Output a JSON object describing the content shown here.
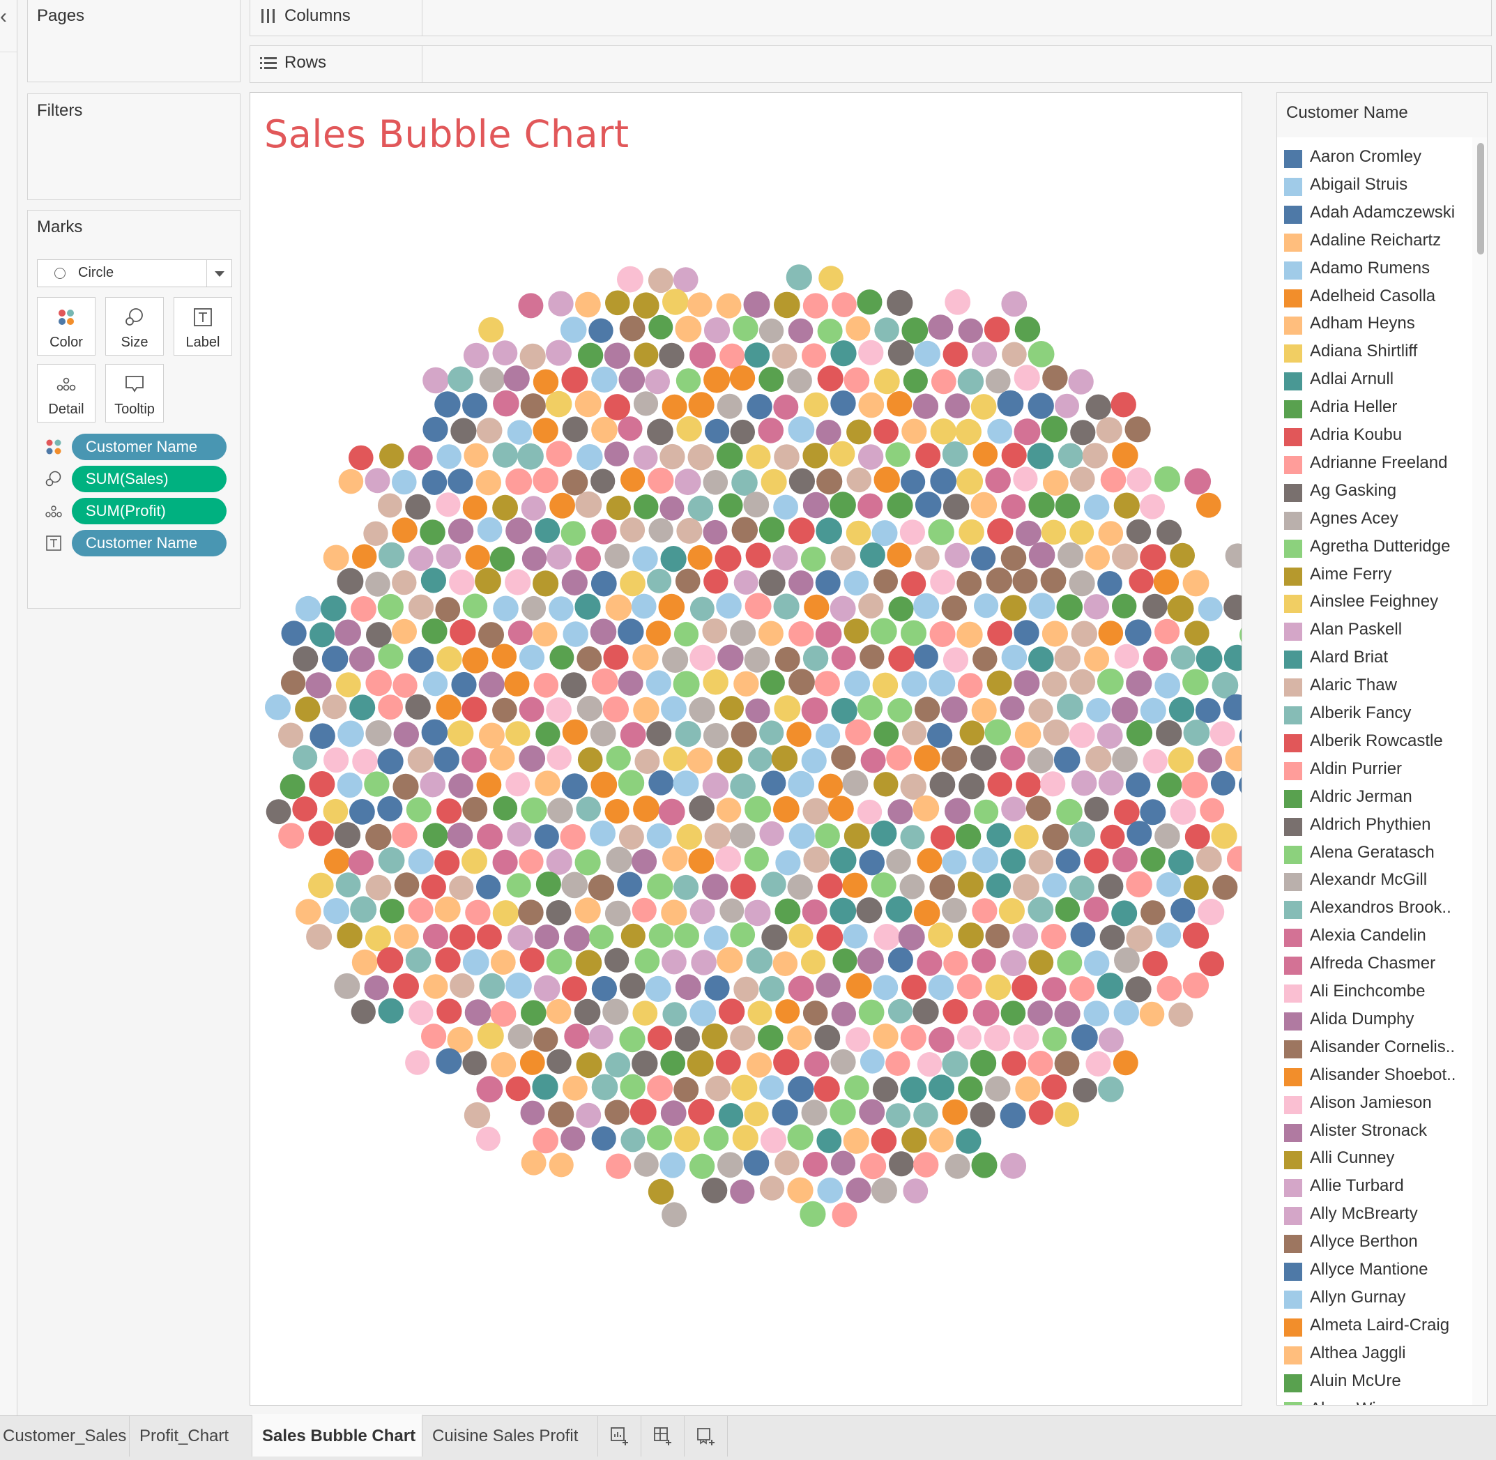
{
  "shelves": {
    "pages_title": "Pages",
    "filters_title": "Filters",
    "marks_title": "Marks",
    "columns_label": "Columns",
    "rows_label": "Rows"
  },
  "marks": {
    "mark_type": "Circle",
    "buttons": {
      "color": "Color",
      "size": "Size",
      "label": "Label",
      "detail": "Detail",
      "tooltip": "Tooltip"
    },
    "fields": [
      {
        "icon": "color-dots-icon",
        "name": "Customer Name",
        "kind": "dimension"
      },
      {
        "icon": "size-icon",
        "name": "SUM(Sales)",
        "kind": "measure"
      },
      {
        "icon": "detail-dots-icon",
        "name": "SUM(Profit)",
        "kind": "measure"
      },
      {
        "icon": "text-label-icon",
        "name": "Customer Name",
        "kind": "dimension"
      }
    ]
  },
  "view": {
    "title": "Sales Bubble Chart",
    "title_color": "#e15759"
  },
  "chart_data": {
    "type": "scatter",
    "subtype": "packed-bubble",
    "title": "Sales Bubble Chart",
    "color_field": "Customer Name",
    "size_field": "SUM(Sales)",
    "palette": [
      "#4e79a7",
      "#a0cbe8",
      "#f28e2b",
      "#ffbe7d",
      "#59a14f",
      "#8cd17d",
      "#b6992d",
      "#f1ce63",
      "#499894",
      "#86bcb6",
      "#e15759",
      "#ff9d9a",
      "#79706e",
      "#bab0ac",
      "#d37295",
      "#fabfd2",
      "#b07aa1",
      "#d4a6c8",
      "#9d7660",
      "#d7b5a6"
    ],
    "bubble_count_approx": 800
  },
  "legend": {
    "title": "Customer Name",
    "items": [
      {
        "name": "Aaron Cromley",
        "color": "#4e79a7"
      },
      {
        "name": "Abigail Struis",
        "color": "#a0cbe8"
      },
      {
        "name": "Adah Adamczewski",
        "color": "#4e79a7"
      },
      {
        "name": "Adaline Reichartz",
        "color": "#ffbe7d"
      },
      {
        "name": "Adamo Rumens",
        "color": "#a0cbe8"
      },
      {
        "name": "Adelheid Casolla",
        "color": "#f28e2b"
      },
      {
        "name": "Adham Heyns",
        "color": "#ffbe7d"
      },
      {
        "name": "Adiana Shirtliff",
        "color": "#f1ce63"
      },
      {
        "name": "Adlai Arnull",
        "color": "#499894"
      },
      {
        "name": "Adria Heller",
        "color": "#59a14f"
      },
      {
        "name": "Adria Koubu",
        "color": "#e15759"
      },
      {
        "name": "Adrianne Freeland",
        "color": "#ff9d9a"
      },
      {
        "name": "Ag Gasking",
        "color": "#79706e"
      },
      {
        "name": "Agnes Acey",
        "color": "#bab0ac"
      },
      {
        "name": "Agretha Dutteridge",
        "color": "#8cd17d"
      },
      {
        "name": "Aime Ferry",
        "color": "#b6992d"
      },
      {
        "name": "Ainslee Feighney",
        "color": "#f1ce63"
      },
      {
        "name": "Alan Paskell",
        "color": "#d4a6c8"
      },
      {
        "name": "Alard Briat",
        "color": "#499894"
      },
      {
        "name": "Alaric Thaw",
        "color": "#d7b5a6"
      },
      {
        "name": "Alberik Fancy",
        "color": "#86bcb6"
      },
      {
        "name": "Alberik Rowcastle",
        "color": "#e15759"
      },
      {
        "name": "Aldin Purrier",
        "color": "#ff9d9a"
      },
      {
        "name": "Aldric Jerman",
        "color": "#59a14f"
      },
      {
        "name": "Aldrich Phythien",
        "color": "#79706e"
      },
      {
        "name": "Alena Geratasch",
        "color": "#8cd17d"
      },
      {
        "name": "Alexandr McGill",
        "color": "#bab0ac"
      },
      {
        "name": "Alexandros Brook..",
        "color": "#86bcb6"
      },
      {
        "name": "Alexia Candelin",
        "color": "#d37295"
      },
      {
        "name": "Alfreda Chasmer",
        "color": "#d37295"
      },
      {
        "name": "Ali Einchcombe",
        "color": "#fabfd2"
      },
      {
        "name": "Alida Dumphy",
        "color": "#b07aa1"
      },
      {
        "name": "Alisander Cornelis..",
        "color": "#9d7660"
      },
      {
        "name": "Alisander Shoebot..",
        "color": "#f28e2b"
      },
      {
        "name": "Alison Jamieson",
        "color": "#fabfd2"
      },
      {
        "name": "Alister Stronack",
        "color": "#b07aa1"
      },
      {
        "name": "Alli Cunney",
        "color": "#b6992d"
      },
      {
        "name": "Allie Turbard",
        "color": "#d4a6c8"
      },
      {
        "name": "Ally McBrearty",
        "color": "#d4a6c8"
      },
      {
        "name": "Allyce Berthon",
        "color": "#9d7660"
      },
      {
        "name": "Allyce Mantione",
        "color": "#4e79a7"
      },
      {
        "name": "Allyn Gurnay",
        "color": "#a0cbe8"
      },
      {
        "name": "Almeta Laird-Craig",
        "color": "#f28e2b"
      },
      {
        "name": "Althea Jaggli",
        "color": "#ffbe7d"
      },
      {
        "name": "Aluin McUre",
        "color": "#59a14f"
      },
      {
        "name": "Alvan Winspare",
        "color": "#8cd17d"
      }
    ]
  },
  "tabs": [
    {
      "label": "Customer_Sales",
      "active": false
    },
    {
      "label": "Profit_Chart",
      "active": false
    },
    {
      "label": "Sales Bubble Chart",
      "active": true
    },
    {
      "label": "Cuisine Sales Profit",
      "active": false
    }
  ],
  "tab_icons": [
    "new-worksheet-icon",
    "new-dashboard-icon",
    "new-story-icon"
  ]
}
